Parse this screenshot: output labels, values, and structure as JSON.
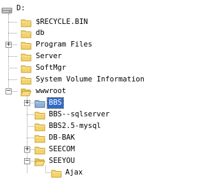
{
  "tree": {
    "root": {
      "label": "D:",
      "icon": "drive-icon",
      "expanded": true
    },
    "items": [
      {
        "label": "$RECYCLE.BIN",
        "icon": "folder-icon",
        "expander": "none"
      },
      {
        "label": "db",
        "icon": "folder-icon",
        "expander": "none"
      },
      {
        "label": "Program Files",
        "icon": "folder-icon",
        "expander": "collapsed"
      },
      {
        "label": "Server",
        "icon": "folder-icon",
        "expander": "none"
      },
      {
        "label": "SoftMgr",
        "icon": "folder-icon",
        "expander": "none"
      },
      {
        "label": "System Volume Information",
        "icon": "folder-icon",
        "expander": "none"
      },
      {
        "label": "wwwroot",
        "icon": "folder-open-icon",
        "expander": "expanded",
        "children": [
          {
            "label": "BBS",
            "icon": "folder-icon",
            "expander": "collapsed",
            "selected": true
          },
          {
            "label": "BBS--sqlserver",
            "icon": "folder-icon",
            "expander": "none"
          },
          {
            "label": "BBS2.5-mysql",
            "icon": "folder-icon",
            "expander": "none"
          },
          {
            "label": "DB-BAK",
            "icon": "folder-icon",
            "expander": "none"
          },
          {
            "label": "SEECOM",
            "icon": "folder-icon",
            "expander": "collapsed"
          },
          {
            "label": "SEEYOU",
            "icon": "folder-open-icon",
            "expander": "expanded",
            "children": [
              {
                "label": "Ajax",
                "icon": "folder-icon",
                "expander": "none"
              }
            ]
          }
        ]
      }
    ]
  },
  "colors": {
    "selection": "#3169c6",
    "folder": "#f3d36b",
    "folder_border": "#c9a033"
  }
}
